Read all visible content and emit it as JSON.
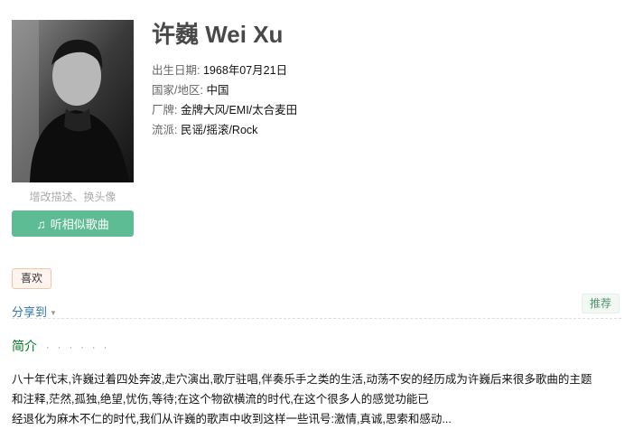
{
  "artist": {
    "name": "许巍 Wei Xu",
    "photo_icon": "artist-photo",
    "edit_link": "增改描述、换头像",
    "listen_button": "听相似歌曲",
    "listen_icon": "music-note-icon"
  },
  "info": [
    {
      "label": "出生日期:",
      "value": "1968年07月21日"
    },
    {
      "label": "国家/地区:",
      "value": "中国"
    },
    {
      "label": "厂牌:",
      "value": "金牌大风/EMI/太合麦田"
    },
    {
      "label": "流派:",
      "value": "民谣/摇滚/Rock"
    }
  ],
  "actions": {
    "like": "喜欢",
    "share": "分享到",
    "recommend": "推荐"
  },
  "intro": {
    "heading": "简介",
    "dots": "· · · · · ·",
    "lines": [
      "八十年代末,许巍过着四处奔波,走穴演出,歌厅驻唱,伴奏乐手之类的生活,动荡不安的经历成为许巍后来很多歌曲的主题",
      "和注释,茫然,孤独,绝望,忧伤,等待;在这个物欲横流的时代,在这个很多人的感觉功能已",
      "经退化为麻木不仁的时代,我们从许巍的歌声中收到这样一些讯号:激情,真诚,思索和感动..."
    ]
  }
}
